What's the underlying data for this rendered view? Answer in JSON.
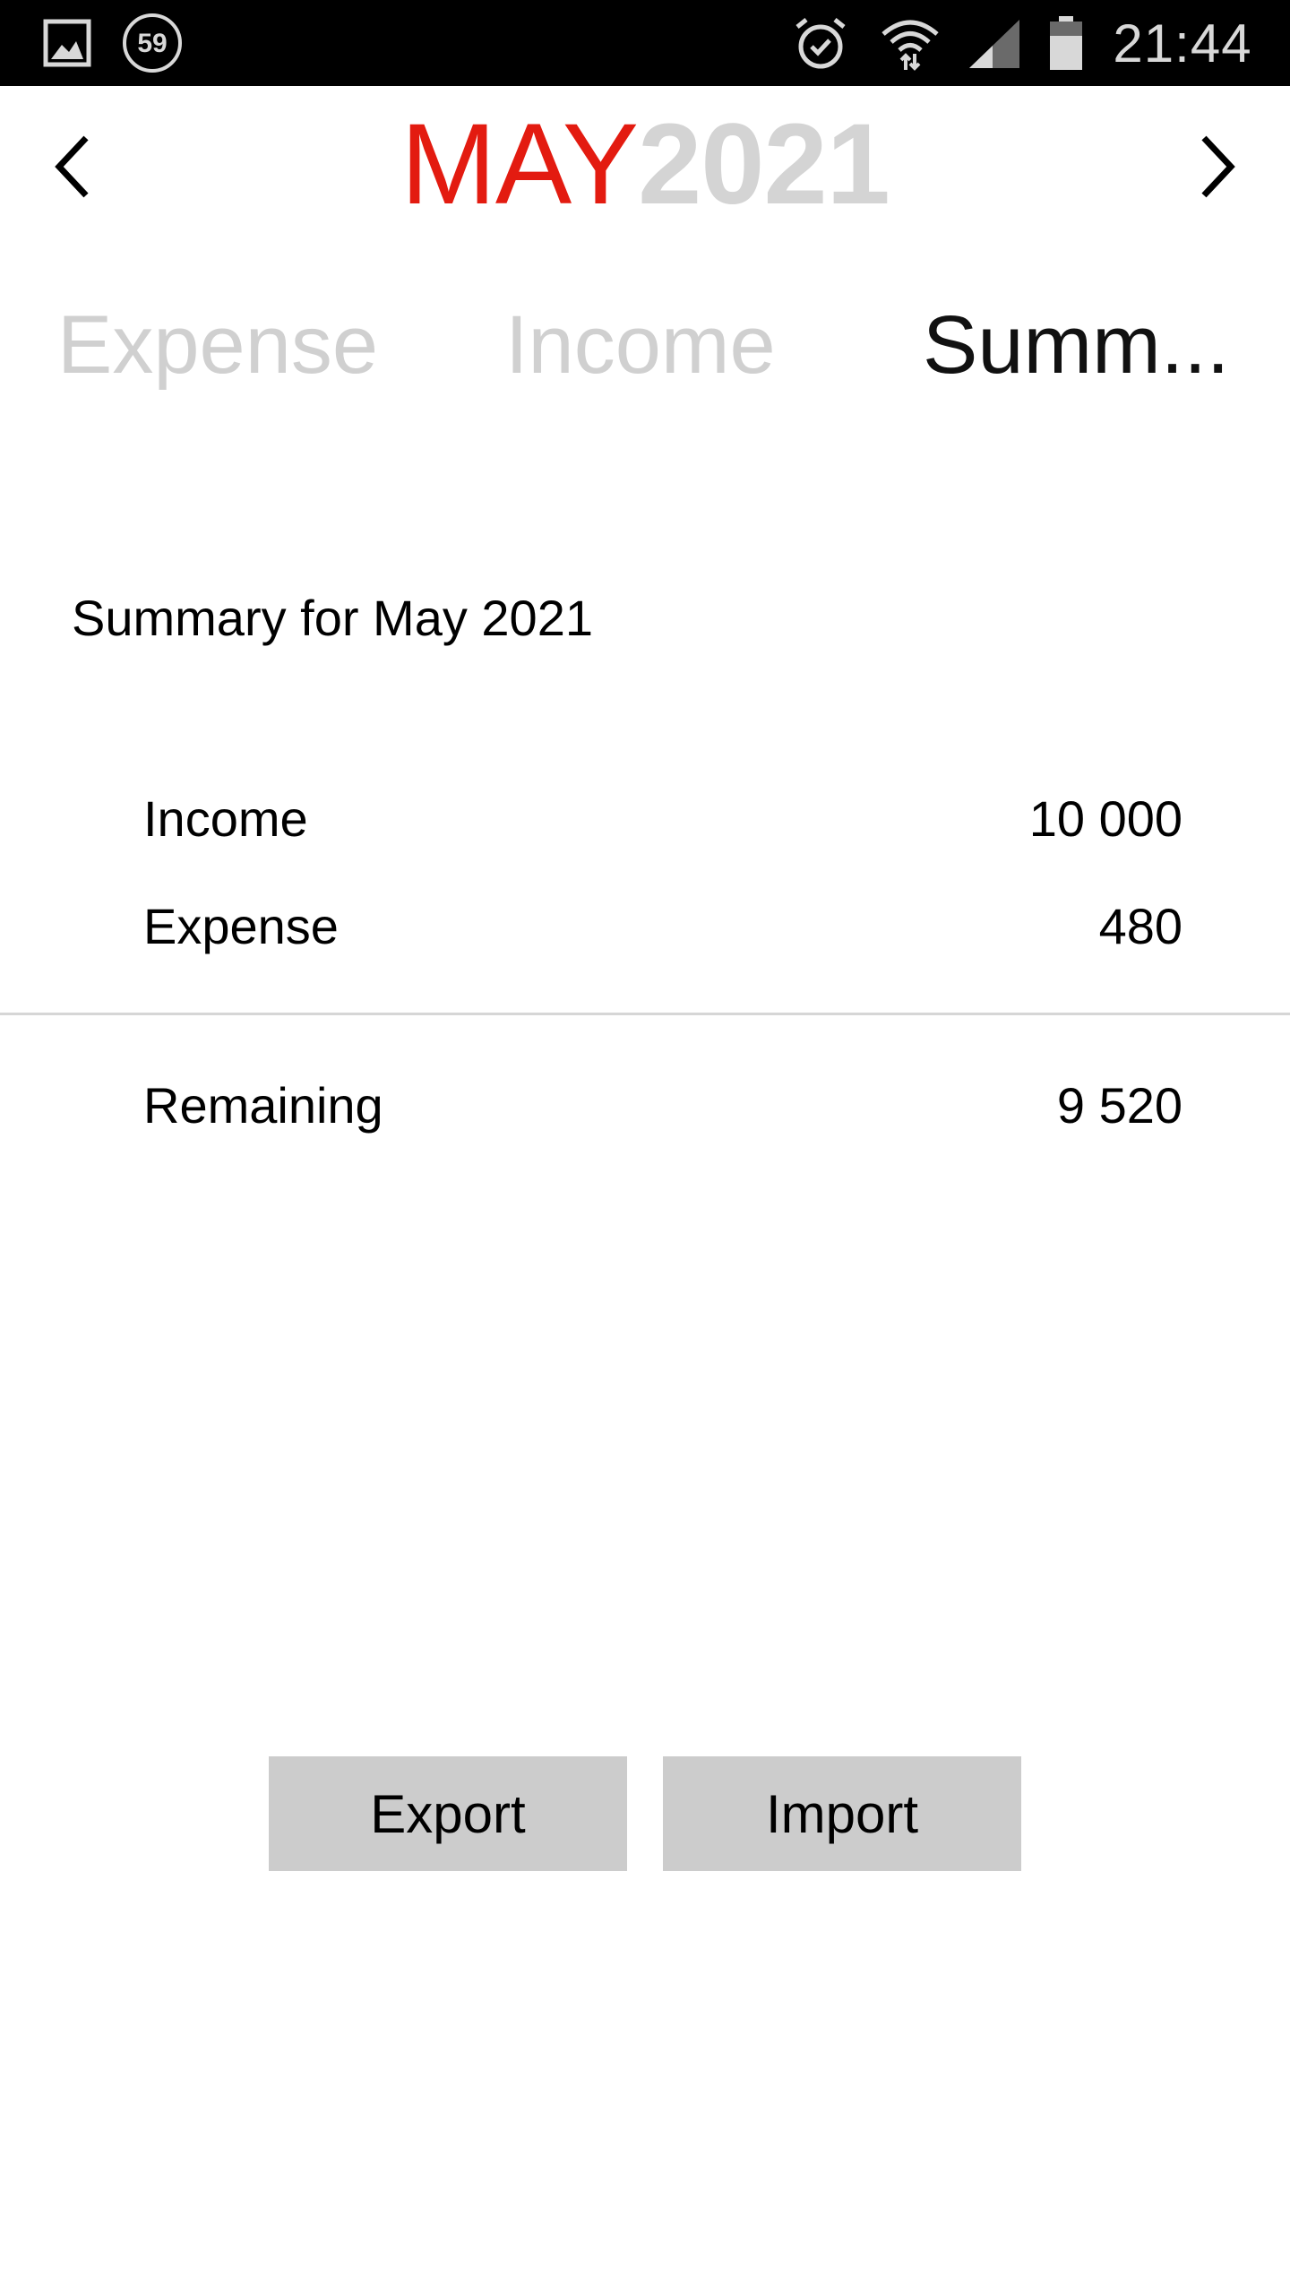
{
  "status_bar": {
    "notification_badge": "59",
    "time": "21:44",
    "icons": [
      "gallery-icon",
      "badge-icon",
      "alarm-icon",
      "wifi-icon",
      "signal-icon",
      "battery-icon"
    ]
  },
  "header": {
    "month": "MAY",
    "year": "2021",
    "prev_icon": "chevron-left-icon",
    "next_icon": "chevron-right-icon",
    "month_color": "#e31b10",
    "year_color": "#d4d4d4"
  },
  "tabs": [
    {
      "label": "Expense",
      "active": false
    },
    {
      "label": "Income",
      "active": false
    },
    {
      "label": "Summ...",
      "active": true
    }
  ],
  "summary": {
    "title": "Summary for May 2021",
    "rows": [
      {
        "label": "Income",
        "value": "10 000"
      },
      {
        "label": "Expense",
        "value": "480"
      }
    ],
    "remaining": {
      "label": "Remaining",
      "value": "9 520"
    }
  },
  "actions": {
    "export_label": "Export",
    "import_label": "Import"
  }
}
